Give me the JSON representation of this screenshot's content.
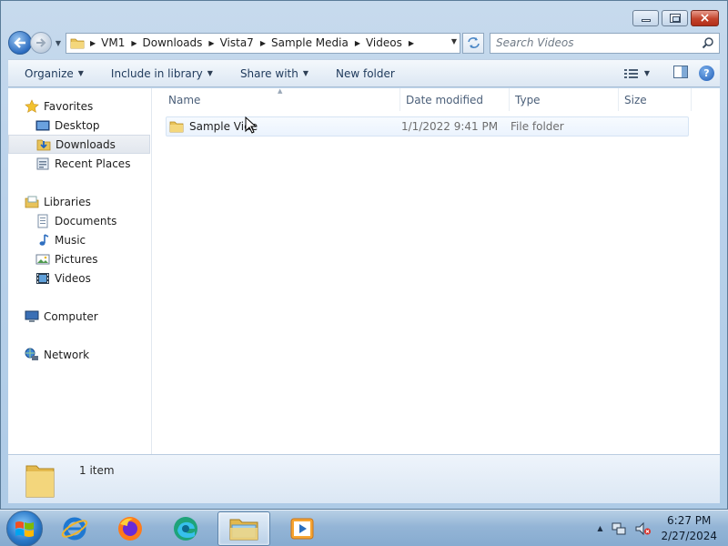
{
  "window": {
    "controls": {
      "minimize": "minimize",
      "maximize": "maximize",
      "close": "×"
    }
  },
  "address": {
    "crumbs": [
      "VM1",
      "Downloads",
      "Vista7",
      "Sample Media",
      "Videos"
    ]
  },
  "search": {
    "placeholder": "Search Videos"
  },
  "toolbar": {
    "organize": "Organize",
    "include_in_library": "Include in library",
    "share_with": "Share with",
    "new_folder": "New folder"
  },
  "nav": {
    "favorites": "Favorites",
    "desktop": "Desktop",
    "downloads": "Downloads",
    "recent_places": "Recent Places",
    "libraries": "Libraries",
    "documents": "Documents",
    "music": "Music",
    "pictures": "Pictures",
    "videos": "Videos",
    "computer": "Computer",
    "network": "Network"
  },
  "columns": {
    "name": "Name",
    "date_modified": "Date modified",
    "type": "Type",
    "size": "Size"
  },
  "files": [
    {
      "name": "Sample Videos",
      "name_visible": "Sample Vide",
      "date_modified": "1/1/2022 9:41 PM",
      "type": "File folder"
    }
  ],
  "details": {
    "count": "1 item"
  },
  "taskbar": {
    "apps": [
      "internet-explorer",
      "firefox",
      "edge",
      "file-explorer",
      "media-player"
    ],
    "active_app": "file-explorer"
  },
  "clock": {
    "time": "6:27 PM",
    "date": "2/27/2024"
  },
  "colors": {
    "selection": "#ebf3fd",
    "taskbar": "#94b5d6",
    "title_gradient": "#b9d1ea"
  }
}
